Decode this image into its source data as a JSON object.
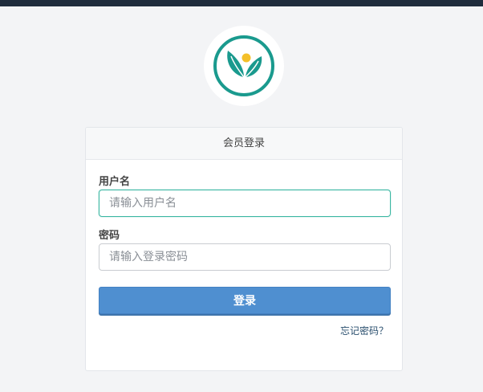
{
  "colors": {
    "accent": "#1a9a8e",
    "primary_button": "#4f8fd0",
    "sun": "#f4c02a",
    "top_bar": "#1f2d3d"
  },
  "logo": {
    "icon": "leaf-sun-logo"
  },
  "card": {
    "title": "会员登录",
    "username": {
      "label": "用户名",
      "placeholder": "请输入用户名",
      "value": ""
    },
    "password": {
      "label": "密码",
      "placeholder": "请输入登录密码",
      "value": ""
    },
    "login_label": "登录",
    "forgot_label": "忘记密码？"
  }
}
